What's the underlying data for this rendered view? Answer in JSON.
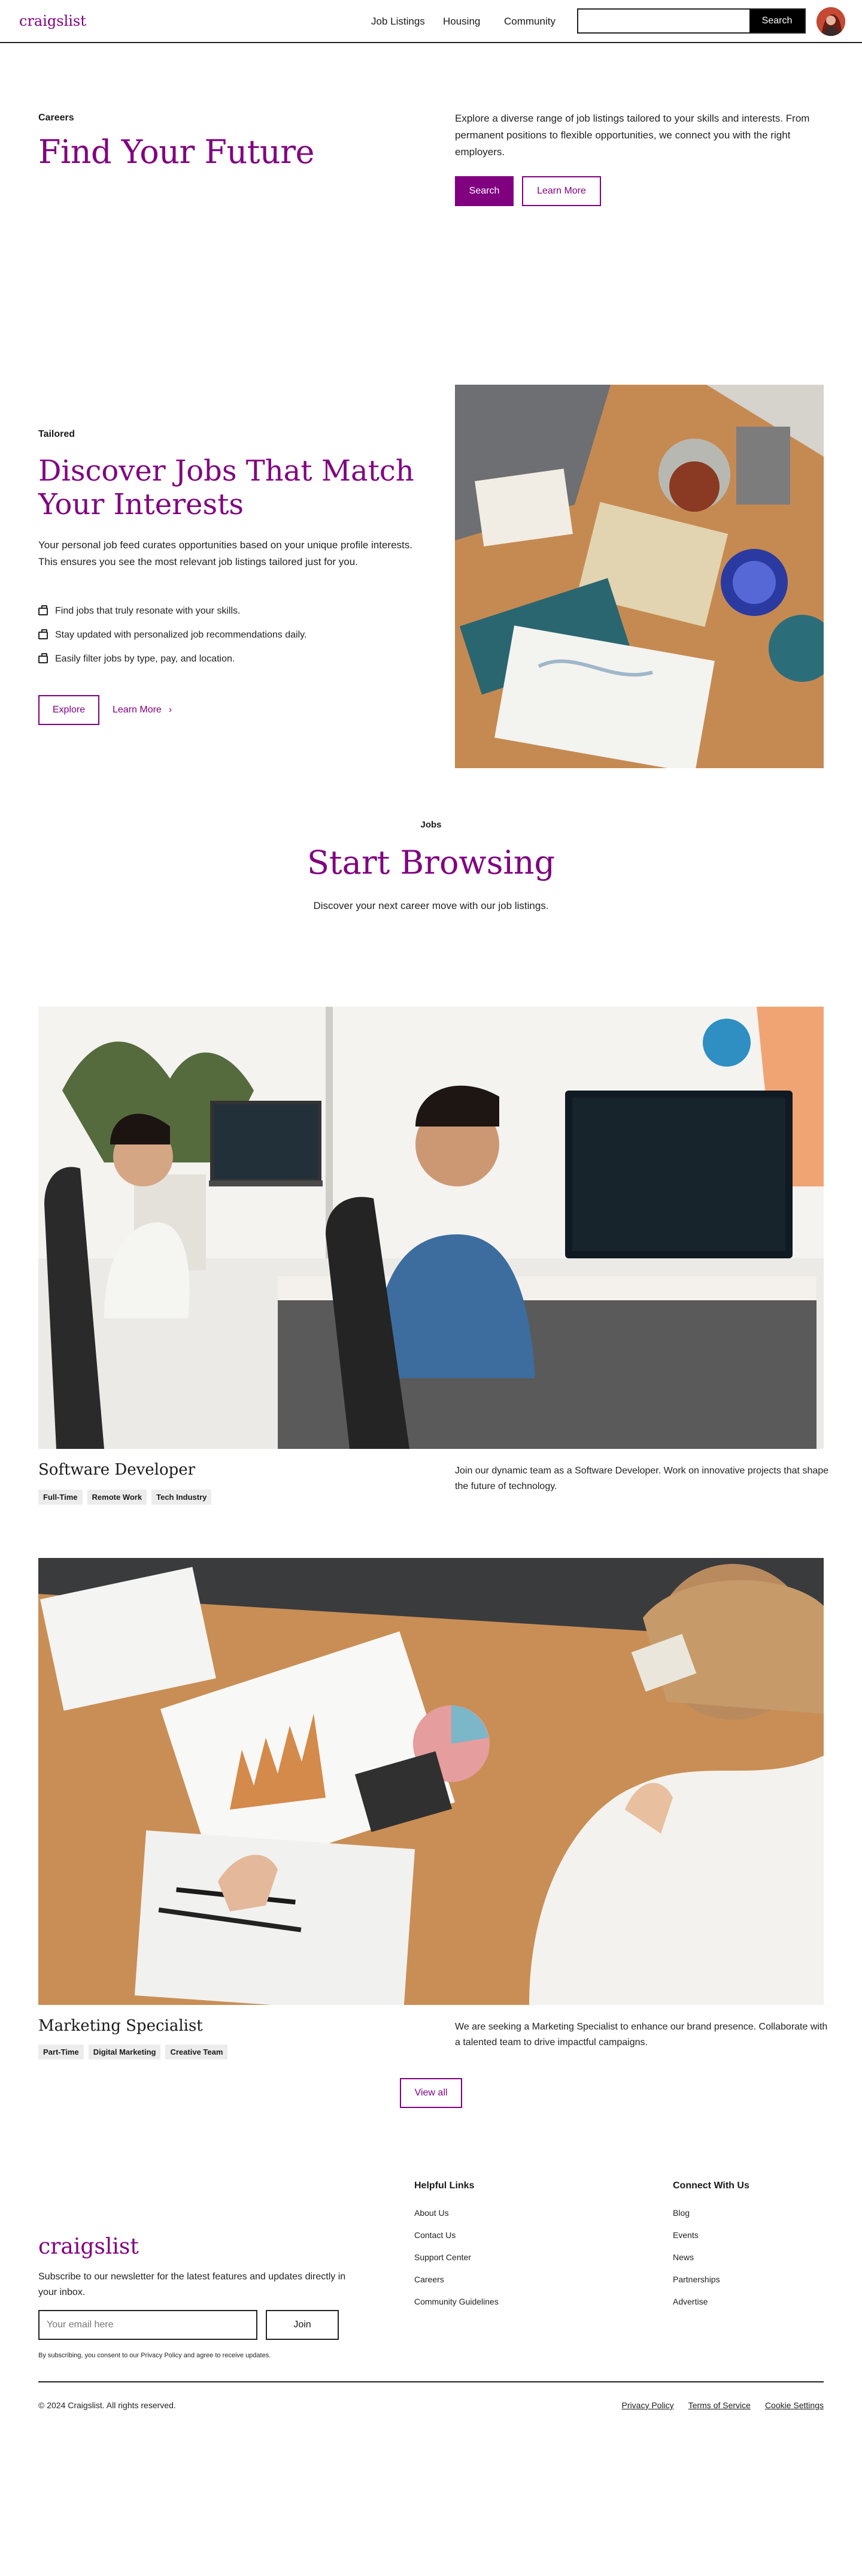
{
  "nav": {
    "logo": "craigslist",
    "links": [
      "Job Listings",
      "Housing",
      "Community"
    ],
    "search_placeholder": "",
    "search_button": "Search"
  },
  "hero": {
    "eyebrow": "Careers",
    "title": "Find Your Future",
    "description": "Explore a diverse range of job listings tailored to your skills and interests. From permanent positions to flexible opportunities, we connect you with the right employers.",
    "primary_button": "Search",
    "secondary_button": "Learn More"
  },
  "feature": {
    "eyebrow": "Tailored",
    "title": "Discover Jobs That Match Your Interests",
    "description": "Your personal job feed curates opportunities based on your unique profile interests. This ensures you see the most relevant job listings tailored just for you.",
    "items": [
      "Find jobs that truly resonate with your skills.",
      "Stay updated with personalized job recommendations daily.",
      "Easily filter jobs by type, pay, and location."
    ],
    "explore_button": "Explore",
    "learn_more_link": "Learn More"
  },
  "browse": {
    "eyebrow": "Jobs",
    "title": "Start Browsing",
    "subtitle": "Discover your next career move with our job listings."
  },
  "jobs": [
    {
      "title": "Software Developer",
      "tags": [
        "Full-Time",
        "Remote Work",
        "Tech Industry"
      ],
      "description": "Join our dynamic team as a Software Developer. Work on innovative projects that shape the future of technology."
    },
    {
      "title": "Marketing Specialist",
      "tags": [
        "Part-Time",
        "Digital Marketing",
        "Creative Team"
      ],
      "description": "We are seeking a Marketing Specialist to enhance our brand presence. Collaborate with a talented team to drive impactful campaigns."
    }
  ],
  "view_all": "View all",
  "footer": {
    "logo": "craigslist",
    "newsletter": "Subscribe to our newsletter for the latest features and updates directly in your inbox.",
    "email_placeholder": "Your email here",
    "join_button": "Join",
    "consent": "By subscribing, you consent to our Privacy Policy and agree to receive updates.",
    "helpful_title": "Helpful Links",
    "helpful_links": [
      "About Us",
      "Contact Us",
      "Support Center",
      "Careers",
      "Community Guidelines"
    ],
    "connect_title": "Connect With Us",
    "connect_links": [
      "Blog",
      "Events",
      "News",
      "Partnerships",
      "Advertise"
    ],
    "copyright": "© 2024 Craigslist. All rights reserved.",
    "legal_links": [
      "Privacy Policy",
      "Terms of Service",
      "Cookie Settings"
    ]
  },
  "colors": {
    "accent": "#800080",
    "text": "#1a1a1a",
    "tag_bg": "#ececec"
  }
}
